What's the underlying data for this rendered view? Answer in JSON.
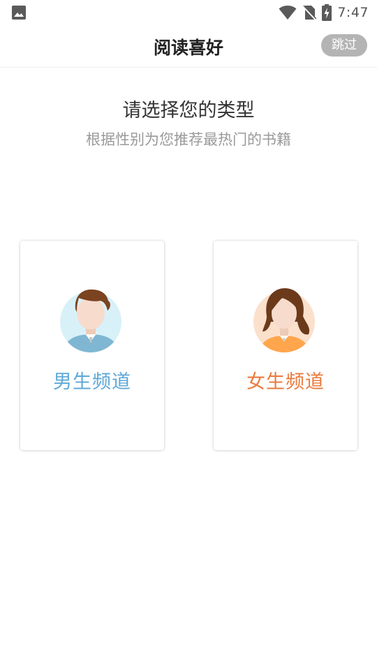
{
  "status_bar": {
    "time": "7:47",
    "icons": [
      "image-icon",
      "wifi-icon",
      "no-sim-icon",
      "battery-charging-icon"
    ]
  },
  "header": {
    "title": "阅读喜好",
    "skip_label": "跳过"
  },
  "main": {
    "heading": "请选择您的类型",
    "subheading": "根据性别为您推荐最热门的书籍",
    "channels": [
      {
        "label": "男生频道",
        "icon": "male-avatar-icon",
        "color": "#5ea8d8"
      },
      {
        "label": "女生频道",
        "icon": "female-avatar-icon",
        "color": "#e97a3d"
      }
    ]
  }
}
